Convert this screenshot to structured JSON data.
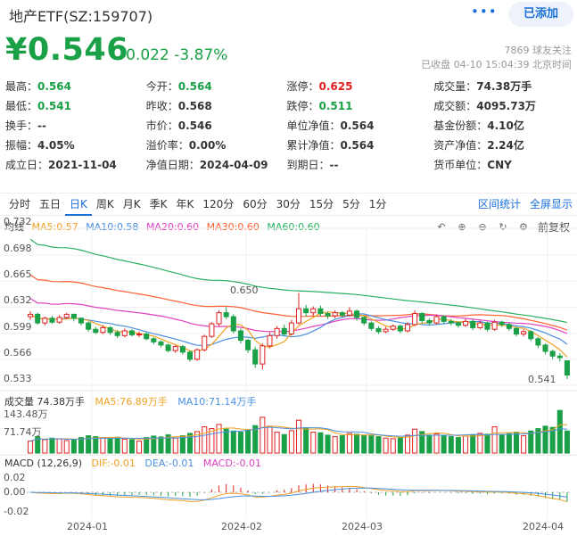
{
  "header": {
    "title": "地产ETF(SZ:159707)",
    "more_icon": "more-dots-icon",
    "added_label": "已添加",
    "price": "¥0.546",
    "change": "-0.022",
    "change_pct": "-3.87%",
    "followers": "7869 球友关注",
    "status": "已收盘 04-10 15:04:39 北京时间"
  },
  "stats": [
    [
      {
        "label": "最高：",
        "value": "0.564",
        "color": "green"
      },
      {
        "label": "今开：",
        "value": "0.564",
        "color": "green"
      },
      {
        "label": "涨停：",
        "value": "0.625",
        "color": "red"
      },
      {
        "label": "成交量：",
        "value": "74.38万手",
        "color": ""
      }
    ],
    [
      {
        "label": "最低：",
        "value": "0.541",
        "color": "green"
      },
      {
        "label": "昨收：",
        "value": "0.568",
        "color": ""
      },
      {
        "label": "跌停：",
        "value": "0.511",
        "color": "green"
      },
      {
        "label": "成交额：",
        "value": "4095.73万",
        "color": ""
      }
    ],
    [
      {
        "label": "换手：",
        "value": "--",
        "color": ""
      },
      {
        "label": "市价：",
        "value": "0.546",
        "color": ""
      },
      {
        "label": "单位净值：",
        "value": "0.564",
        "color": ""
      },
      {
        "label": "基金份额：",
        "value": "4.10亿",
        "color": ""
      }
    ],
    [
      {
        "label": "振幅：",
        "value": "4.05%",
        "color": ""
      },
      {
        "label": "溢价率：",
        "value": "0.00%",
        "color": ""
      },
      {
        "label": "累计净值：",
        "value": "0.564",
        "color": ""
      },
      {
        "label": "资产净值：",
        "value": "2.24亿",
        "color": ""
      }
    ],
    [
      {
        "label": "成立日：",
        "value": "2021-11-04",
        "color": ""
      },
      {
        "label": "净值日期：",
        "value": "2024-04-09",
        "color": ""
      },
      {
        "label": "到期日：",
        "value": "--",
        "color": ""
      },
      {
        "label": "货币单位：",
        "value": "CNY",
        "color": ""
      }
    ]
  ],
  "tabs": [
    "分时",
    "五日",
    "日K",
    "周K",
    "月K",
    "季K",
    "年K",
    "120分",
    "60分",
    "30分",
    "15分",
    "5分",
    "1分"
  ],
  "active_tab": "日K",
  "right_tabs": [
    "区间统计",
    "全屏显示"
  ],
  "kline_legend": {
    "type": "均线",
    "ma5": "MA5:0.57",
    "ma10": "MA10:0.58",
    "ma20": "MA20:0.60",
    "ma30": "MA30:0.60",
    "ma60": "MA60:0.60"
  },
  "tools": {
    "icons": [
      "undo-icon",
      "zoom-in-icon",
      "zoom-out-icon",
      "reset-icon",
      "settings-icon"
    ],
    "adjust": "前复权"
  },
  "price_axis": [
    "0.732",
    "0.698",
    "0.665",
    "0.632",
    "0.599",
    "0.566",
    "0.533"
  ],
  "annotations": {
    "high": "0.650",
    "low": "0.541"
  },
  "volume_legend": {
    "vol": "成交量 74.38万手",
    "ma5": "MA5:76.89万手",
    "ma10": "MA10:71.14万手"
  },
  "volume_axis": [
    "143.48万",
    "71.74万"
  ],
  "macd_legend": {
    "title": "MACD (12,26,9)",
    "dif": "DIF:-0.01",
    "dea": "DEA:-0.01",
    "macd": "MACD:-0.01"
  },
  "macd_axis": [
    "0.02",
    "0.00",
    "-0.02"
  ],
  "date_axis": [
    "2024-01",
    "2024-02",
    "2024-03",
    "2024-04"
  ],
  "colors": {
    "up": "#e02020",
    "down": "#1aa046",
    "accent": "#1a6fd8",
    "ma5": "#f0a020",
    "ma10": "#4a8fe0",
    "ma20": "#e040c0",
    "ma30": "#ff6030",
    "ma60": "#28b060"
  },
  "chart_data": {
    "type": "candlestick",
    "series": [
      {
        "o": 0.62,
        "c": 0.623,
        "h": 0.627,
        "l": 0.616,
        "v": 40
      },
      {
        "o": 0.623,
        "c": 0.612,
        "h": 0.625,
        "l": 0.61,
        "v": 55
      },
      {
        "o": 0.612,
        "c": 0.618,
        "h": 0.62,
        "l": 0.609,
        "v": 45
      },
      {
        "o": 0.618,
        "c": 0.613,
        "h": 0.621,
        "l": 0.611,
        "v": 50
      },
      {
        "o": 0.613,
        "c": 0.619,
        "h": 0.622,
        "l": 0.611,
        "v": 48
      },
      {
        "o": 0.619,
        "c": 0.623,
        "h": 0.625,
        "l": 0.617,
        "v": 42
      },
      {
        "o": 0.623,
        "c": 0.618,
        "h": 0.624,
        "l": 0.614,
        "v": 46
      },
      {
        "o": 0.618,
        "c": 0.612,
        "h": 0.619,
        "l": 0.609,
        "v": 52
      },
      {
        "o": 0.612,
        "c": 0.604,
        "h": 0.614,
        "l": 0.601,
        "v": 58
      },
      {
        "o": 0.604,
        "c": 0.6,
        "h": 0.607,
        "l": 0.598,
        "v": 55
      },
      {
        "o": 0.6,
        "c": 0.606,
        "h": 0.609,
        "l": 0.598,
        "v": 50
      },
      {
        "o": 0.606,
        "c": 0.6,
        "h": 0.608,
        "l": 0.597,
        "v": 48
      },
      {
        "o": 0.6,
        "c": 0.596,
        "h": 0.603,
        "l": 0.593,
        "v": 53
      },
      {
        "o": 0.596,
        "c": 0.602,
        "h": 0.605,
        "l": 0.594,
        "v": 47
      },
      {
        "o": 0.602,
        "c": 0.597,
        "h": 0.604,
        "l": 0.595,
        "v": 45
      },
      {
        "o": 0.597,
        "c": 0.598,
        "h": 0.601,
        "l": 0.594,
        "v": 40
      },
      {
        "o": 0.598,
        "c": 0.592,
        "h": 0.6,
        "l": 0.59,
        "v": 52
      },
      {
        "o": 0.592,
        "c": 0.588,
        "h": 0.594,
        "l": 0.585,
        "v": 57
      },
      {
        "o": 0.588,
        "c": 0.584,
        "h": 0.59,
        "l": 0.581,
        "v": 54
      },
      {
        "o": 0.584,
        "c": 0.577,
        "h": 0.586,
        "l": 0.575,
        "v": 61
      },
      {
        "o": 0.577,
        "c": 0.582,
        "h": 0.584,
        "l": 0.574,
        "v": 50
      },
      {
        "o": 0.582,
        "c": 0.575,
        "h": 0.584,
        "l": 0.572,
        "v": 58
      },
      {
        "o": 0.575,
        "c": 0.566,
        "h": 0.577,
        "l": 0.563,
        "v": 66
      },
      {
        "o": 0.566,
        "c": 0.578,
        "h": 0.58,
        "l": 0.564,
        "v": 72
      },
      {
        "o": 0.578,
        "c": 0.595,
        "h": 0.597,
        "l": 0.576,
        "v": 88
      },
      {
        "o": 0.595,
        "c": 0.611,
        "h": 0.613,
        "l": 0.593,
        "v": 82
      },
      {
        "o": 0.611,
        "c": 0.625,
        "h": 0.628,
        "l": 0.608,
        "v": 96
      },
      {
        "o": 0.625,
        "c": 0.62,
        "h": 0.632,
        "l": 0.617,
        "v": 80
      },
      {
        "o": 0.62,
        "c": 0.602,
        "h": 0.623,
        "l": 0.599,
        "v": 74
      },
      {
        "o": 0.602,
        "c": 0.59,
        "h": 0.605,
        "l": 0.586,
        "v": 70
      },
      {
        "o": 0.59,
        "c": 0.578,
        "h": 0.592,
        "l": 0.574,
        "v": 76
      },
      {
        "o": 0.578,
        "c": 0.56,
        "h": 0.582,
        "l": 0.555,
        "v": 92
      },
      {
        "o": 0.56,
        "c": 0.583,
        "h": 0.586,
        "l": 0.553,
        "v": 120
      },
      {
        "o": 0.583,
        "c": 0.596,
        "h": 0.6,
        "l": 0.58,
        "v": 90
      },
      {
        "o": 0.596,
        "c": 0.605,
        "h": 0.608,
        "l": 0.592,
        "v": 70
      },
      {
        "o": 0.605,
        "c": 0.598,
        "h": 0.61,
        "l": 0.595,
        "v": 62
      },
      {
        "o": 0.598,
        "c": 0.612,
        "h": 0.616,
        "l": 0.596,
        "v": 75
      },
      {
        "o": 0.612,
        "c": 0.63,
        "h": 0.65,
        "l": 0.61,
        "v": 110
      },
      {
        "o": 0.63,
        "c": 0.625,
        "h": 0.635,
        "l": 0.62,
        "v": 85
      },
      {
        "o": 0.625,
        "c": 0.63,
        "h": 0.633,
        "l": 0.621,
        "v": 70
      },
      {
        "o": 0.63,
        "c": 0.624,
        "h": 0.634,
        "l": 0.62,
        "v": 68
      },
      {
        "o": 0.624,
        "c": 0.621,
        "h": 0.626,
        "l": 0.617,
        "v": 60
      },
      {
        "o": 0.621,
        "c": 0.625,
        "h": 0.628,
        "l": 0.618,
        "v": 55
      },
      {
        "o": 0.625,
        "c": 0.622,
        "h": 0.627,
        "l": 0.619,
        "v": 58
      },
      {
        "o": 0.622,
        "c": 0.627,
        "h": 0.632,
        "l": 0.62,
        "v": 66
      },
      {
        "o": 0.627,
        "c": 0.619,
        "h": 0.629,
        "l": 0.615,
        "v": 63
      },
      {
        "o": 0.619,
        "c": 0.612,
        "h": 0.621,
        "l": 0.609,
        "v": 60
      },
      {
        "o": 0.612,
        "c": 0.605,
        "h": 0.614,
        "l": 0.602,
        "v": 58
      },
      {
        "o": 0.605,
        "c": 0.601,
        "h": 0.608,
        "l": 0.598,
        "v": 55
      },
      {
        "o": 0.601,
        "c": 0.604,
        "h": 0.607,
        "l": 0.599,
        "v": 50
      },
      {
        "o": 0.604,
        "c": 0.608,
        "h": 0.61,
        "l": 0.602,
        "v": 48
      },
      {
        "o": 0.608,
        "c": 0.602,
        "h": 0.61,
        "l": 0.599,
        "v": 52
      },
      {
        "o": 0.602,
        "c": 0.61,
        "h": 0.613,
        "l": 0.6,
        "v": 60
      },
      {
        "o": 0.61,
        "c": 0.624,
        "h": 0.628,
        "l": 0.608,
        "v": 80
      },
      {
        "o": 0.624,
        "c": 0.615,
        "h": 0.626,
        "l": 0.612,
        "v": 72
      },
      {
        "o": 0.615,
        "c": 0.612,
        "h": 0.618,
        "l": 0.609,
        "v": 60
      },
      {
        "o": 0.612,
        "c": 0.62,
        "h": 0.623,
        "l": 0.61,
        "v": 64
      },
      {
        "o": 0.62,
        "c": 0.614,
        "h": 0.622,
        "l": 0.611,
        "v": 58
      },
      {
        "o": 0.614,
        "c": 0.612,
        "h": 0.617,
        "l": 0.609,
        "v": 55
      },
      {
        "o": 0.612,
        "c": 0.609,
        "h": 0.614,
        "l": 0.606,
        "v": 52
      },
      {
        "o": 0.609,
        "c": 0.614,
        "h": 0.617,
        "l": 0.607,
        "v": 57
      },
      {
        "o": 0.614,
        "c": 0.606,
        "h": 0.616,
        "l": 0.603,
        "v": 62
      },
      {
        "o": 0.606,
        "c": 0.612,
        "h": 0.615,
        "l": 0.604,
        "v": 66
      },
      {
        "o": 0.612,
        "c": 0.604,
        "h": 0.614,
        "l": 0.601,
        "v": 63
      },
      {
        "o": 0.604,
        "c": 0.613,
        "h": 0.616,
        "l": 0.602,
        "v": 88
      },
      {
        "o": 0.613,
        "c": 0.61,
        "h": 0.615,
        "l": 0.607,
        "v": 60
      },
      {
        "o": 0.61,
        "c": 0.605,
        "h": 0.612,
        "l": 0.602,
        "v": 65
      },
      {
        "o": 0.605,
        "c": 0.598,
        "h": 0.607,
        "l": 0.595,
        "v": 70
      },
      {
        "o": 0.598,
        "c": 0.601,
        "h": 0.604,
        "l": 0.595,
        "v": 58
      },
      {
        "o": 0.601,
        "c": 0.592,
        "h": 0.603,
        "l": 0.589,
        "v": 74
      },
      {
        "o": 0.592,
        "c": 0.584,
        "h": 0.594,
        "l": 0.58,
        "v": 82
      },
      {
        "o": 0.584,
        "c": 0.576,
        "h": 0.586,
        "l": 0.572,
        "v": 90
      },
      {
        "o": 0.576,
        "c": 0.57,
        "h": 0.578,
        "l": 0.566,
        "v": 86
      },
      {
        "o": 0.57,
        "c": 0.568,
        "h": 0.574,
        "l": 0.563,
        "v": 143
      },
      {
        "o": 0.564,
        "c": 0.546,
        "h": 0.564,
        "l": 0.541,
        "v": 74
      }
    ],
    "ylim": [
      0.533,
      0.732
    ],
    "volume_max": 143.48,
    "xlabels": [
      "2024-01",
      "2024-02",
      "2024-03",
      "2024-04"
    ]
  }
}
